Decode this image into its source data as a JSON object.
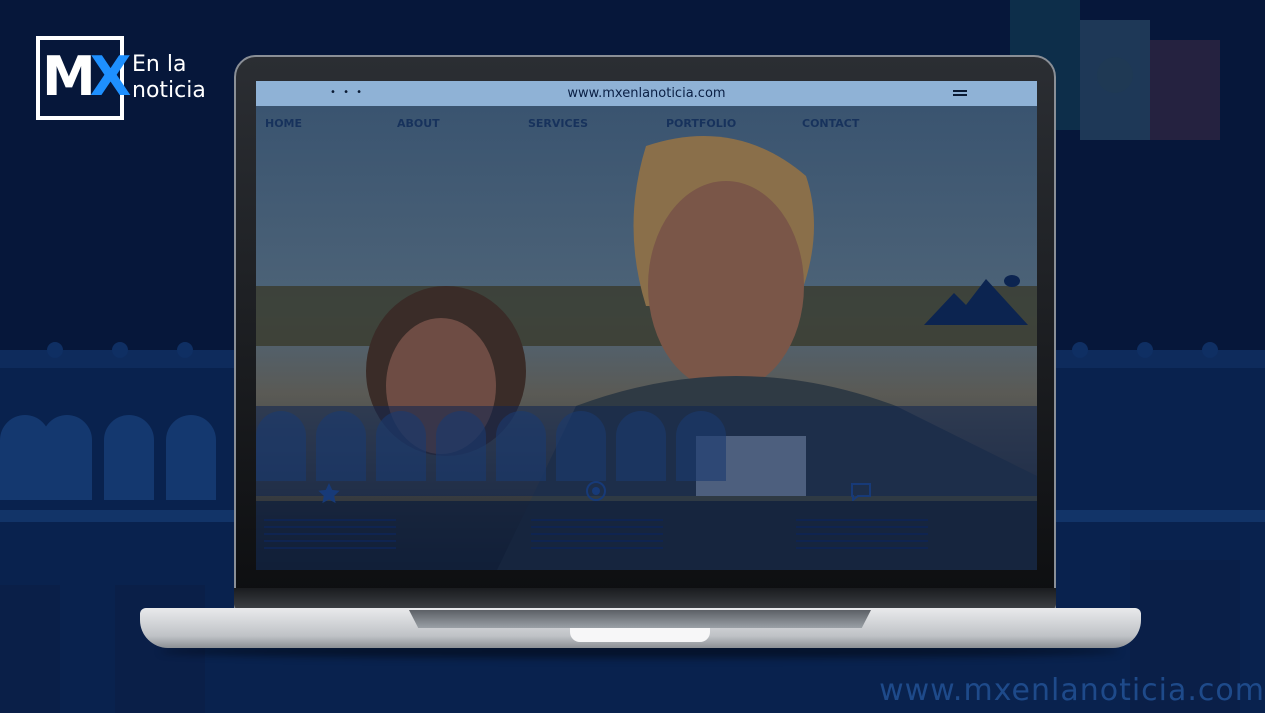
{
  "brand": {
    "logo_mark": "MX",
    "logo_line1": "En la",
    "logo_line2": "noticia",
    "accent_color": "#1e90ff",
    "background_color": "#06173a"
  },
  "browser": {
    "dots": "• • •",
    "url": "www.mxenlanoticia.com",
    "menu_icon": "hamburger-icon"
  },
  "site_nav": {
    "items": [
      "HOME",
      "ABOUT",
      "SERVICES",
      "PORTFOLIO",
      "CONTACT"
    ]
  },
  "screen_icons": [
    "mountain-image-icon",
    "star-icon",
    "badge-icon",
    "chat-icon"
  ],
  "watermark": "www.mxenlanoticia.com"
}
